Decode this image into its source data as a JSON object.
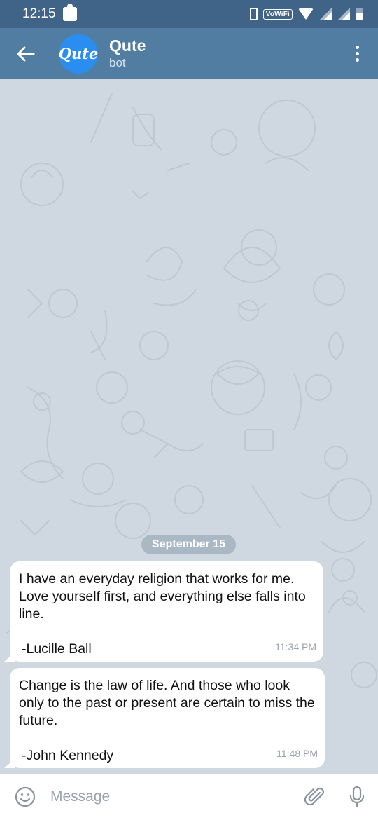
{
  "status_bar": {
    "time": "12:15",
    "vowifi": "VoWiFi"
  },
  "header": {
    "title": "Qute",
    "subtitle": "bot",
    "avatar_text": "Qute"
  },
  "date_separator": "September 15",
  "messages": [
    {
      "text": "I have an everyday religion that works for me. Love yourself first, and everything else falls into line.",
      "author": "-Lucille Ball",
      "time": "11:34 PM"
    },
    {
      "text": "Change is the law of life. And those who look only to the past or present are certain to miss the future.",
      "author": "-John Kennedy",
      "time": "11:48 PM"
    }
  ],
  "input": {
    "placeholder": "Message"
  },
  "colors": {
    "status_bar": "#406487",
    "header": "#527da3",
    "avatar": "#2a8ef0",
    "chat_bg": "#cfd8e0",
    "date_pill": "#a9b8c4"
  }
}
